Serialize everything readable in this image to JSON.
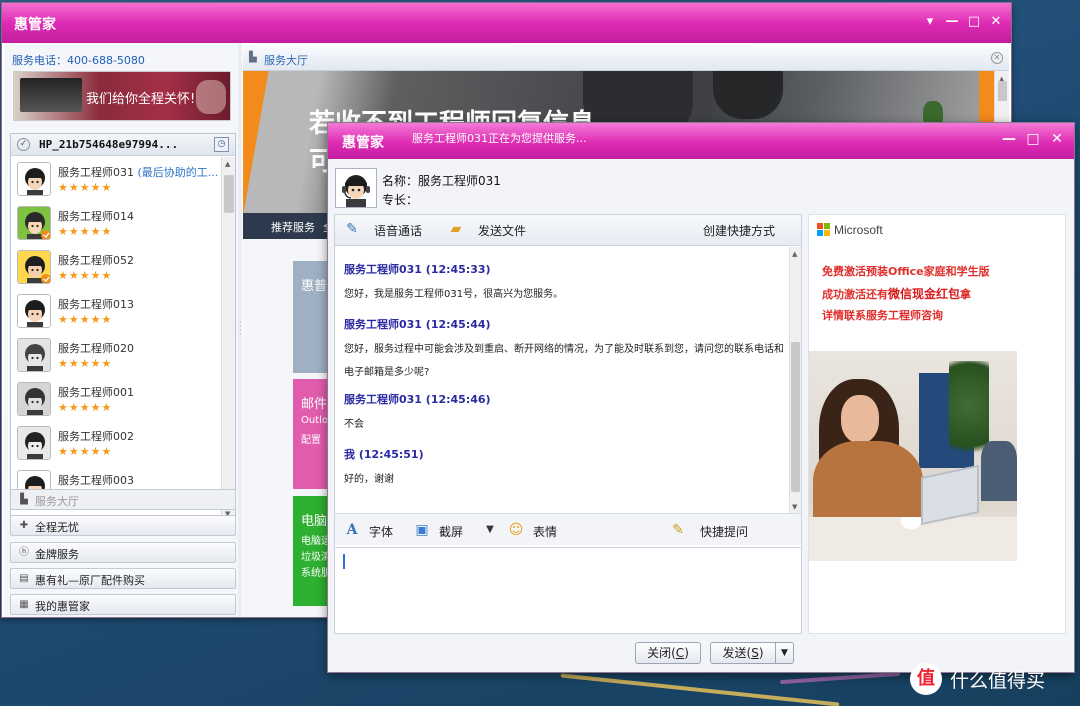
{
  "main_window": {
    "title": "惠管家",
    "controls": {
      "dropdown": "▾",
      "minimize": "—",
      "maximize": "□",
      "close": "✕"
    }
  },
  "sidebar": {
    "hotline": "服务电话：400-688-5080",
    "banner_text": "我们给你全程关怀!",
    "device_name": "HP_21b754648e97994...",
    "contacts": [
      {
        "name": "服务工程师031",
        "tag": "(最后协助的工...",
        "rating": "★★★★★"
      },
      {
        "name": "服务工程师014",
        "tag": "",
        "rating": "★★★★★"
      },
      {
        "name": "服务工程师052",
        "tag": "",
        "rating": "★★★★★"
      },
      {
        "name": "服务工程师013",
        "tag": "",
        "rating": "★★★★★"
      },
      {
        "name": "服务工程师020",
        "tag": "",
        "rating": "★★★★★"
      },
      {
        "name": "服务工程师001",
        "tag": "",
        "rating": "★★★★★"
      },
      {
        "name": "服务工程师002",
        "tag": "",
        "rating": "★★★★★"
      },
      {
        "name": "服务工程师003",
        "tag": "",
        "rating": ""
      }
    ],
    "nav": [
      {
        "label": "服务大厅",
        "icon": "hall-icon"
      },
      {
        "label": "全程无忧",
        "icon": "plus-icon"
      },
      {
        "label": "金牌服务",
        "icon": "hp-icon"
      },
      {
        "label": "惠有礼—原厂配件购买",
        "icon": "cart-icon"
      },
      {
        "label": "我的惠管家",
        "icon": "user-card-icon"
      }
    ]
  },
  "hall": {
    "tab_label": "服务大厅",
    "hero_line1": "若收不到工程师回复信息",
    "hero_line2": "可",
    "subnav_label": "推荐服务",
    "subnav_label2": "全",
    "cards": [
      {
        "title": "惠普",
        "l1": "",
        "l2": "",
        "l3": "",
        "color": "#9fb0c4"
      },
      {
        "title": "邮件",
        "l1": "Outlo",
        "l2": "配置",
        "l3": "",
        "color": "#e25cae"
      },
      {
        "title": "电脑",
        "l1": "电脑运",
        "l2": "垃圾清",
        "l3": "系统肌",
        "color": "#2db02f"
      }
    ]
  },
  "chat": {
    "title": "惠管家",
    "status": "服务工程师031正在为您提供服务...",
    "engineer_name": "名称：服务工程师031",
    "engineer_spec": "专长：",
    "toolbar": {
      "voice_call": "语音通话",
      "send_file": "发送文件",
      "create_shortcut": "创建快捷方式"
    },
    "messages": [
      {
        "sender": "服务工程师031  (12:45:33)",
        "text": "您好，我是服务工程师031号，很高兴为您服务。"
      },
      {
        "sender": "服务工程师031  (12:45:44)",
        "text": "您好，服务过程中可能会涉及到重启、断开网络的情况，为了能及时联系到您，请问您的联系电话和电子邮箱是多少呢?"
      },
      {
        "sender": "服务工程师031  (12:45:46)",
        "text": "不会"
      },
      {
        "sender": "我 (12:45:51)",
        "text": "好的，谢谢"
      }
    ],
    "input_toolbar": {
      "font": "字体",
      "screenshot": "截屏",
      "emoji": "表情",
      "quick_question": "快捷提问"
    },
    "footer": {
      "close_label": "关闭(",
      "close_key": "C",
      "close_end": ")",
      "send_label": "发送(",
      "send_key": "S",
      "send_end": ")"
    }
  },
  "ad": {
    "brand": "Microsoft",
    "line1": "免费激活预装Office家庭和学生版",
    "line2_a": "成功激活还有",
    "line2_hl": "微信现金红包",
    "line2_b": "拿",
    "line3": "详情联系服务工程师咨询"
  },
  "watermark": {
    "logo": "值",
    "text": "什么值得买"
  },
  "colors": {
    "title_magenta": "#de2cb4",
    "link_blue": "#2e6ab7",
    "sender_blue": "#2a2aa2",
    "ad_red": "#e0302d",
    "star_orange": "#f39b17"
  }
}
